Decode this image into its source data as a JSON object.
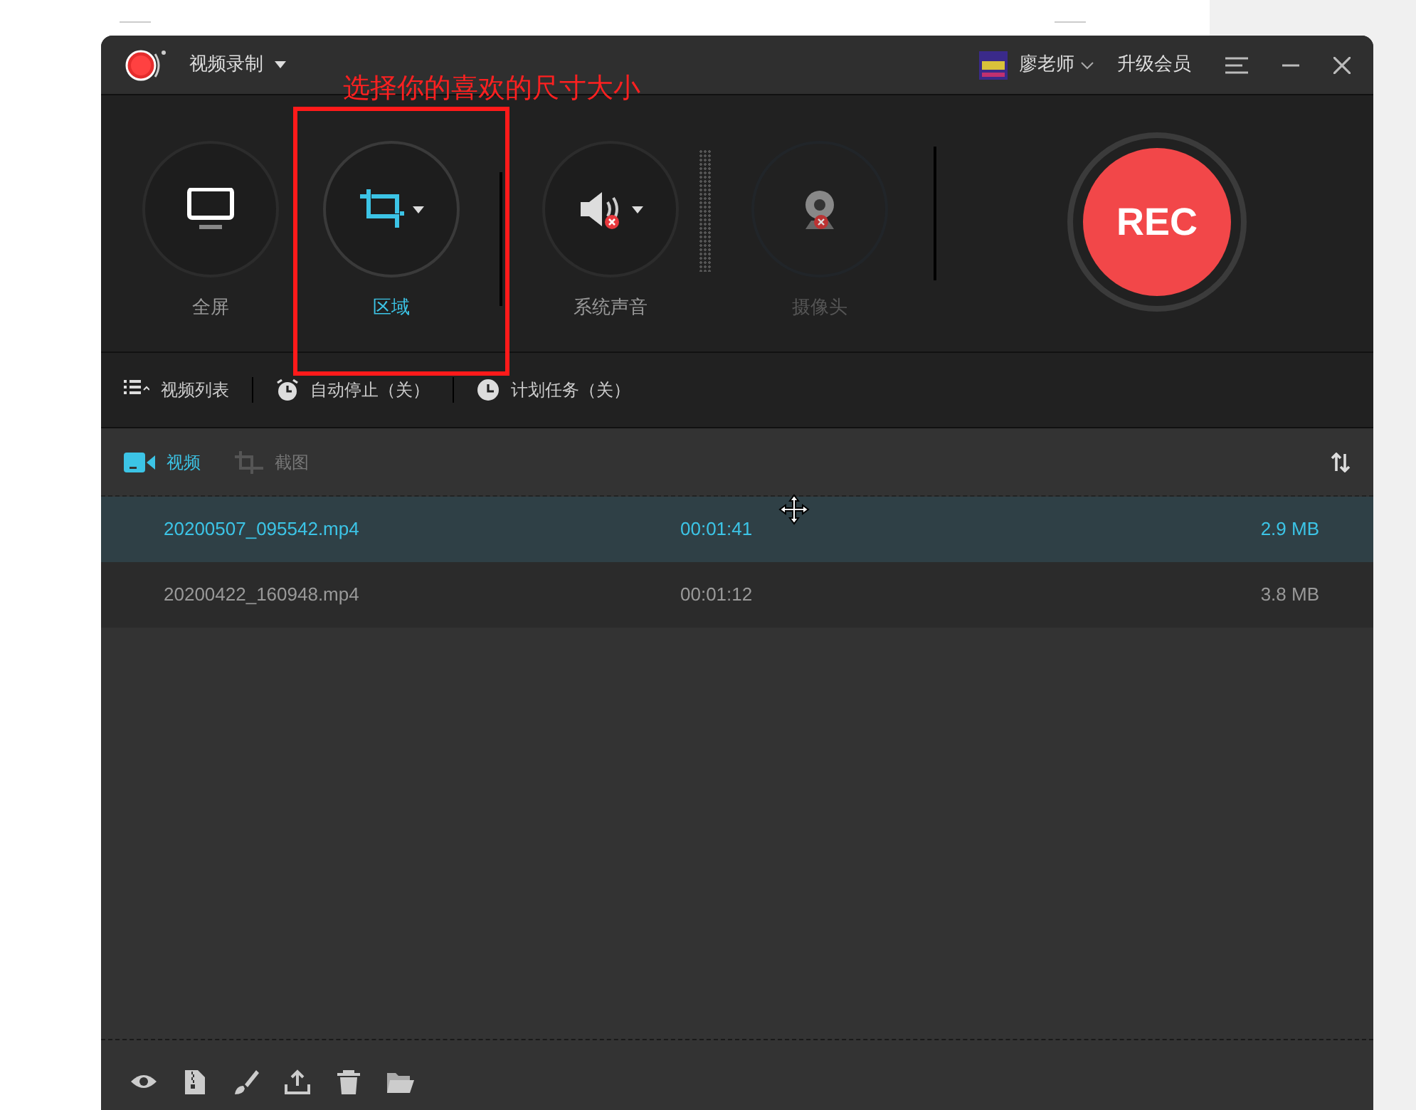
{
  "window": {
    "title": "视频录制",
    "user": "廖老师",
    "upgrade": "升级会员"
  },
  "modes": [
    {
      "label": "全屏",
      "kind": "screen",
      "selected": false,
      "disabled": false
    },
    {
      "label": "区域",
      "kind": "region",
      "selected": true,
      "disabled": false
    },
    {
      "label": "系统声音",
      "kind": "audio",
      "selected": false,
      "disabled": false
    },
    {
      "label": "摄像头",
      "kind": "webcam",
      "selected": false,
      "disabled": true
    }
  ],
  "rec_button": {
    "label": "REC"
  },
  "toolbar": [
    {
      "label": "视频列表",
      "kind": "list"
    },
    {
      "label": "自动停止（关）",
      "kind": "alarm"
    },
    {
      "label": "计划任务（关）",
      "kind": "clock"
    }
  ],
  "tabs": [
    {
      "label": "视频",
      "kind": "video",
      "selected": true
    },
    {
      "label": "截图",
      "kind": "screenshot",
      "selected": false
    }
  ],
  "rows": [
    {
      "name": "20200507_095542.mp4",
      "duration": "00:01:41",
      "size": "2.9 MB",
      "selected": true
    },
    {
      "name": "20200422_160948.mp4",
      "duration": "00:01:12",
      "size": "3.8 MB",
      "selected": false
    }
  ],
  "annotation": {
    "text": "选择你的喜欢的尺寸大小"
  }
}
